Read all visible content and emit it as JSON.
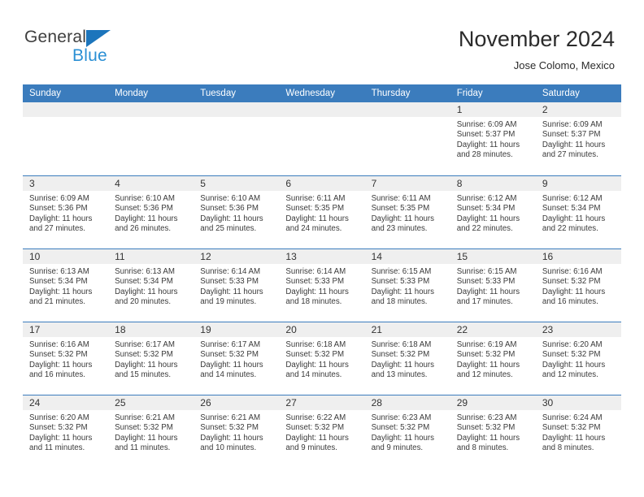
{
  "brand": {
    "name_part1": "General",
    "name_part2": "Blue",
    "triangle_icon": "triangle-icon",
    "color_dark": "#3f3f3f",
    "color_blue": "#2a8fd4",
    "triangle_color": "#1c75bc"
  },
  "header": {
    "title": "November 2024",
    "subtitle": "Jose Colomo, Mexico"
  },
  "theme": {
    "header_row_bg": "#3b7cbd",
    "header_row_text": "#ffffff",
    "daynum_band_bg": "#efefef",
    "week_separator": "#3b7cbd",
    "cell_bg": "#ffffff",
    "body_text": "#3a3a3a"
  },
  "weekdays": [
    "Sunday",
    "Monday",
    "Tuesday",
    "Wednesday",
    "Thursday",
    "Friday",
    "Saturday"
  ],
  "weeks": [
    [
      {
        "day": "",
        "sunrise": "",
        "sunset": "",
        "daylight_line1": "",
        "daylight_line2": "",
        "blank": true
      },
      {
        "day": "",
        "sunrise": "",
        "sunset": "",
        "daylight_line1": "",
        "daylight_line2": "",
        "blank": true
      },
      {
        "day": "",
        "sunrise": "",
        "sunset": "",
        "daylight_line1": "",
        "daylight_line2": "",
        "blank": true
      },
      {
        "day": "",
        "sunrise": "",
        "sunset": "",
        "daylight_line1": "",
        "daylight_line2": "",
        "blank": true
      },
      {
        "day": "",
        "sunrise": "",
        "sunset": "",
        "daylight_line1": "",
        "daylight_line2": "",
        "blank": true
      },
      {
        "day": "1",
        "sunrise": "Sunrise: 6:09 AM",
        "sunset": "Sunset: 5:37 PM",
        "daylight_line1": "Daylight: 11 hours",
        "daylight_line2": "and 28 minutes.",
        "blank": false
      },
      {
        "day": "2",
        "sunrise": "Sunrise: 6:09 AM",
        "sunset": "Sunset: 5:37 PM",
        "daylight_line1": "Daylight: 11 hours",
        "daylight_line2": "and 27 minutes.",
        "blank": false
      }
    ],
    [
      {
        "day": "3",
        "sunrise": "Sunrise: 6:09 AM",
        "sunset": "Sunset: 5:36 PM",
        "daylight_line1": "Daylight: 11 hours",
        "daylight_line2": "and 27 minutes.",
        "blank": false
      },
      {
        "day": "4",
        "sunrise": "Sunrise: 6:10 AM",
        "sunset": "Sunset: 5:36 PM",
        "daylight_line1": "Daylight: 11 hours",
        "daylight_line2": "and 26 minutes.",
        "blank": false
      },
      {
        "day": "5",
        "sunrise": "Sunrise: 6:10 AM",
        "sunset": "Sunset: 5:36 PM",
        "daylight_line1": "Daylight: 11 hours",
        "daylight_line2": "and 25 minutes.",
        "blank": false
      },
      {
        "day": "6",
        "sunrise": "Sunrise: 6:11 AM",
        "sunset": "Sunset: 5:35 PM",
        "daylight_line1": "Daylight: 11 hours",
        "daylight_line2": "and 24 minutes.",
        "blank": false
      },
      {
        "day": "7",
        "sunrise": "Sunrise: 6:11 AM",
        "sunset": "Sunset: 5:35 PM",
        "daylight_line1": "Daylight: 11 hours",
        "daylight_line2": "and 23 minutes.",
        "blank": false
      },
      {
        "day": "8",
        "sunrise": "Sunrise: 6:12 AM",
        "sunset": "Sunset: 5:34 PM",
        "daylight_line1": "Daylight: 11 hours",
        "daylight_line2": "and 22 minutes.",
        "blank": false
      },
      {
        "day": "9",
        "sunrise": "Sunrise: 6:12 AM",
        "sunset": "Sunset: 5:34 PM",
        "daylight_line1": "Daylight: 11 hours",
        "daylight_line2": "and 22 minutes.",
        "blank": false
      }
    ],
    [
      {
        "day": "10",
        "sunrise": "Sunrise: 6:13 AM",
        "sunset": "Sunset: 5:34 PM",
        "daylight_line1": "Daylight: 11 hours",
        "daylight_line2": "and 21 minutes.",
        "blank": false
      },
      {
        "day": "11",
        "sunrise": "Sunrise: 6:13 AM",
        "sunset": "Sunset: 5:34 PM",
        "daylight_line1": "Daylight: 11 hours",
        "daylight_line2": "and 20 minutes.",
        "blank": false
      },
      {
        "day": "12",
        "sunrise": "Sunrise: 6:14 AM",
        "sunset": "Sunset: 5:33 PM",
        "daylight_line1": "Daylight: 11 hours",
        "daylight_line2": "and 19 minutes.",
        "blank": false
      },
      {
        "day": "13",
        "sunrise": "Sunrise: 6:14 AM",
        "sunset": "Sunset: 5:33 PM",
        "daylight_line1": "Daylight: 11 hours",
        "daylight_line2": "and 18 minutes.",
        "blank": false
      },
      {
        "day": "14",
        "sunrise": "Sunrise: 6:15 AM",
        "sunset": "Sunset: 5:33 PM",
        "daylight_line1": "Daylight: 11 hours",
        "daylight_line2": "and 18 minutes.",
        "blank": false
      },
      {
        "day": "15",
        "sunrise": "Sunrise: 6:15 AM",
        "sunset": "Sunset: 5:33 PM",
        "daylight_line1": "Daylight: 11 hours",
        "daylight_line2": "and 17 minutes.",
        "blank": false
      },
      {
        "day": "16",
        "sunrise": "Sunrise: 6:16 AM",
        "sunset": "Sunset: 5:32 PM",
        "daylight_line1": "Daylight: 11 hours",
        "daylight_line2": "and 16 minutes.",
        "blank": false
      }
    ],
    [
      {
        "day": "17",
        "sunrise": "Sunrise: 6:16 AM",
        "sunset": "Sunset: 5:32 PM",
        "daylight_line1": "Daylight: 11 hours",
        "daylight_line2": "and 16 minutes.",
        "blank": false
      },
      {
        "day": "18",
        "sunrise": "Sunrise: 6:17 AM",
        "sunset": "Sunset: 5:32 PM",
        "daylight_line1": "Daylight: 11 hours",
        "daylight_line2": "and 15 minutes.",
        "blank": false
      },
      {
        "day": "19",
        "sunrise": "Sunrise: 6:17 AM",
        "sunset": "Sunset: 5:32 PM",
        "daylight_line1": "Daylight: 11 hours",
        "daylight_line2": "and 14 minutes.",
        "blank": false
      },
      {
        "day": "20",
        "sunrise": "Sunrise: 6:18 AM",
        "sunset": "Sunset: 5:32 PM",
        "daylight_line1": "Daylight: 11 hours",
        "daylight_line2": "and 14 minutes.",
        "blank": false
      },
      {
        "day": "21",
        "sunrise": "Sunrise: 6:18 AM",
        "sunset": "Sunset: 5:32 PM",
        "daylight_line1": "Daylight: 11 hours",
        "daylight_line2": "and 13 minutes.",
        "blank": false
      },
      {
        "day": "22",
        "sunrise": "Sunrise: 6:19 AM",
        "sunset": "Sunset: 5:32 PM",
        "daylight_line1": "Daylight: 11 hours",
        "daylight_line2": "and 12 minutes.",
        "blank": false
      },
      {
        "day": "23",
        "sunrise": "Sunrise: 6:20 AM",
        "sunset": "Sunset: 5:32 PM",
        "daylight_line1": "Daylight: 11 hours",
        "daylight_line2": "and 12 minutes.",
        "blank": false
      }
    ],
    [
      {
        "day": "24",
        "sunrise": "Sunrise: 6:20 AM",
        "sunset": "Sunset: 5:32 PM",
        "daylight_line1": "Daylight: 11 hours",
        "daylight_line2": "and 11 minutes.",
        "blank": false
      },
      {
        "day": "25",
        "sunrise": "Sunrise: 6:21 AM",
        "sunset": "Sunset: 5:32 PM",
        "daylight_line1": "Daylight: 11 hours",
        "daylight_line2": "and 11 minutes.",
        "blank": false
      },
      {
        "day": "26",
        "sunrise": "Sunrise: 6:21 AM",
        "sunset": "Sunset: 5:32 PM",
        "daylight_line1": "Daylight: 11 hours",
        "daylight_line2": "and 10 minutes.",
        "blank": false
      },
      {
        "day": "27",
        "sunrise": "Sunrise: 6:22 AM",
        "sunset": "Sunset: 5:32 PM",
        "daylight_line1": "Daylight: 11 hours",
        "daylight_line2": "and 9 minutes.",
        "blank": false
      },
      {
        "day": "28",
        "sunrise": "Sunrise: 6:23 AM",
        "sunset": "Sunset: 5:32 PM",
        "daylight_line1": "Daylight: 11 hours",
        "daylight_line2": "and 9 minutes.",
        "blank": false
      },
      {
        "day": "29",
        "sunrise": "Sunrise: 6:23 AM",
        "sunset": "Sunset: 5:32 PM",
        "daylight_line1": "Daylight: 11 hours",
        "daylight_line2": "and 8 minutes.",
        "blank": false
      },
      {
        "day": "30",
        "sunrise": "Sunrise: 6:24 AM",
        "sunset": "Sunset: 5:32 PM",
        "daylight_line1": "Daylight: 11 hours",
        "daylight_line2": "and 8 minutes.",
        "blank": false
      }
    ]
  ]
}
